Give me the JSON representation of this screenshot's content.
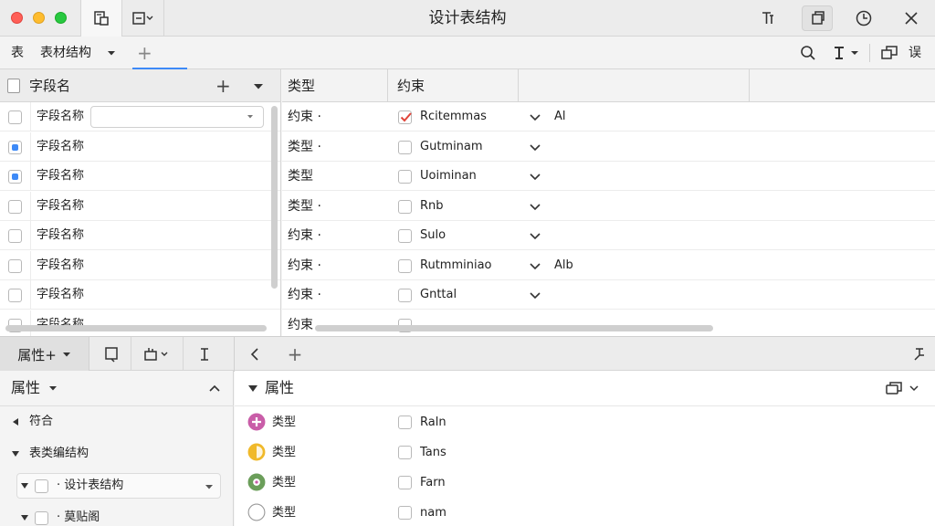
{
  "window": {
    "title": "设计表结构",
    "traffic_lights": {
      "close": "#ff5f57",
      "minimize": "#febc2e",
      "zoom": "#28c840"
    }
  },
  "titlebar": {
    "tab_icons": [
      "table-grid-icon",
      "panel-dropdown-icon"
    ],
    "right_icons": [
      "text-style-icon",
      "copy-icon",
      "clock-icon",
      "close-icon"
    ]
  },
  "toolbar": {
    "label_table": "表",
    "label_structure": "表材结构",
    "add_tab": "+",
    "right_icons": [
      "search-icon",
      "text-format-icon",
      "layout-icon"
    ],
    "right_label": "误"
  },
  "field_pane": {
    "header": "字段名",
    "add": "+",
    "rows": [
      {
        "label": "字段名称",
        "checked": false,
        "has_input": true
      },
      {
        "label": "字段名称",
        "checked": true
      },
      {
        "label": "字段名称",
        "checked": true
      },
      {
        "label": "字段名称",
        "checked": false
      },
      {
        "label": "字段名称",
        "checked": false
      },
      {
        "label": "字段名称",
        "checked": false
      },
      {
        "label": "字段名称",
        "checked": false
      },
      {
        "label": "字段名称",
        "checked": false
      }
    ]
  },
  "schema_table": {
    "col_type": "类型",
    "col_constraint": "约束",
    "rows": [
      {
        "type": "约束 ·",
        "checked": true,
        "value": "Rcitemmas",
        "extra": "Al"
      },
      {
        "type": "类型 ·",
        "checked": false,
        "value": "Gutminam",
        "extra": ""
      },
      {
        "type": "类型",
        "checked": false,
        "value": "Uoiminan",
        "extra": ""
      },
      {
        "type": "类型 ·",
        "checked": false,
        "value": "Rnb",
        "extra": ""
      },
      {
        "type": "约束 ·",
        "checked": false,
        "value": "Sulo",
        "extra": ""
      },
      {
        "type": "约束 ·",
        "checked": false,
        "value": "Rutmminiao",
        "extra": "Alb"
      },
      {
        "type": "约束 ·",
        "checked": false,
        "value": "Gnttal",
        "extra": ""
      },
      {
        "type": "约束",
        "checked": false,
        "value": "",
        "extra": ""
      }
    ]
  },
  "bottom_bar": {
    "tab_label": "属性+",
    "icons": [
      "doc-icon",
      "chart-dropdown-icon",
      "cursor-icon",
      "chevron-left-icon",
      "plus-icon",
      "pin-icon"
    ],
    "add": "+"
  },
  "props_left": {
    "title": "属性",
    "tree": [
      {
        "label": "符合",
        "level": 0,
        "arrow": "left"
      },
      {
        "label": "表类编结构",
        "level": 0,
        "arrow": "down"
      },
      {
        "label": "· 设计表结构",
        "level": 1,
        "arrow": "down",
        "dropdown": true
      },
      {
        "label": "· 莫贴阁",
        "level": 1,
        "arrow": "down"
      }
    ]
  },
  "props_right": {
    "title": "属性",
    "rows": [
      {
        "label": "类型",
        "value": "Raln",
        "dot_color": "#c95da8",
        "dot_icon": "plus-icon"
      },
      {
        "label": "类型",
        "value": "Tans",
        "dot_color": "#f0b92a",
        "dot_icon": "half-circle-icon"
      },
      {
        "label": "类型",
        "value": "Farn",
        "dot_color": "#6b9e5a",
        "dot_icon": "flower-icon"
      },
      {
        "label": "类型",
        "value": "nam",
        "dot_color": "#ffffff",
        "dot_icon": "empty-circle-icon"
      }
    ]
  }
}
